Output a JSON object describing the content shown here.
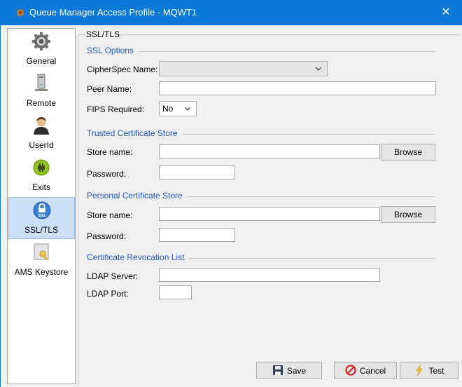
{
  "window": {
    "title": "Queue Manager Access Profile - MQWT1",
    "close_glyph": "✕"
  },
  "sidebar": {
    "items": [
      {
        "label": "General",
        "icon": "gear-icon"
      },
      {
        "label": "Remote",
        "icon": "computer-icon"
      },
      {
        "label": "UserId",
        "icon": "user-icon"
      },
      {
        "label": "Exits",
        "icon": "plug-icon"
      },
      {
        "label": "SSL/TLS",
        "icon": "ssl-lock-icon",
        "active": true
      },
      {
        "label": "AMS Keystore",
        "icon": "keystore-icon"
      }
    ]
  },
  "panel": {
    "title": "SSL/TLS",
    "ssl_options": {
      "title": "SSL Options",
      "cipherspec_label": "CipherSpec Name:",
      "cipherspec_value": "",
      "peer_name_label": "Peer Name:",
      "peer_name_value": "",
      "fips_label": "FIPS Required:",
      "fips_value": "No"
    },
    "trusted_store": {
      "title": "Trusted Certificate Store",
      "store_name_label": "Store name:",
      "store_name_value": "",
      "browse_label": "Browse",
      "password_label": "Password:",
      "password_value": ""
    },
    "personal_store": {
      "title": "Personal Certificate Store",
      "store_name_label": "Store name:",
      "store_name_value": "",
      "browse_label": "Browse",
      "password_label": "Password:",
      "password_value": ""
    },
    "crl": {
      "title": "Certificate Revocation List",
      "ldap_server_label": "LDAP Server:",
      "ldap_server_value": "",
      "ldap_port_label": "LDAP Port:",
      "ldap_port_value": ""
    }
  },
  "buttons": {
    "save": "Save",
    "cancel": "Cancel",
    "test": "Test"
  },
  "colors": {
    "titlebar": "#0a78d7",
    "section_title": "#2257c8",
    "active_nav": "#cce0f7"
  }
}
